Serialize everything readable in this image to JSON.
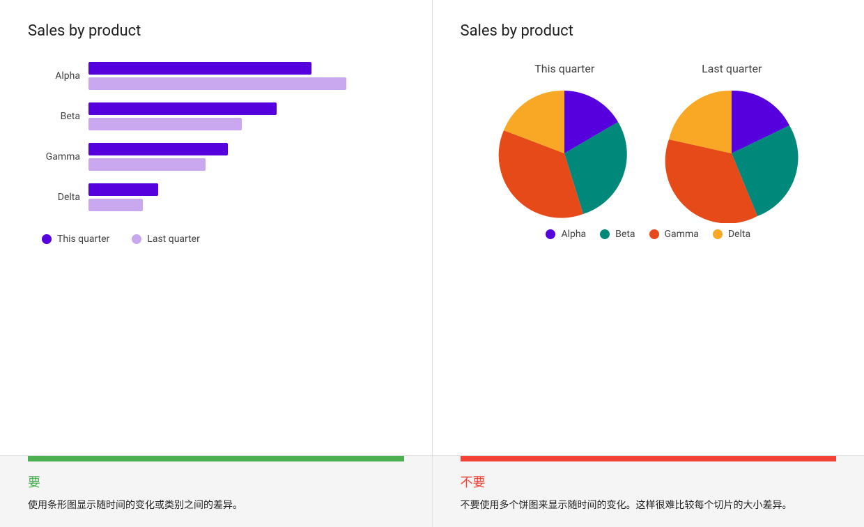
{
  "left_panel": {
    "title": "Sales by product",
    "bars": [
      {
        "label": "Alpha",
        "primary": 320,
        "secondary": 370,
        "max": 420
      },
      {
        "label": "Beta",
        "primary": 270,
        "secondary": 220,
        "max": 420
      },
      {
        "label": "Gamma",
        "primary": 200,
        "secondary": 170,
        "max": 420
      },
      {
        "label": "Delta",
        "primary": 100,
        "secondary": 80,
        "max": 420
      }
    ],
    "legend": [
      {
        "label": "This quarter",
        "color": "#5500dd"
      },
      {
        "label": "Last quarter",
        "color": "#c9a8f0"
      }
    ]
  },
  "right_panel": {
    "title": "Sales by product",
    "this_quarter_label": "This quarter",
    "last_quarter_label": "Last quarter",
    "legend": [
      {
        "label": "Alpha",
        "color": "#5500dd"
      },
      {
        "label": "Beta",
        "color": "#00897b"
      },
      {
        "label": "Gamma",
        "color": "#e64a19"
      },
      {
        "label": "Delta",
        "color": "#f9a825"
      }
    ]
  },
  "bottom_left": {
    "accent_color": "#4caf50",
    "heading": "要",
    "text": "使用条形图显示随时间的变化或类别之间的差异。"
  },
  "bottom_right": {
    "accent_color": "#f44336",
    "heading": "不要",
    "text": "不要使用多个饼图来显示随时间的变化。这样很难比较每个切片的大小差异。"
  }
}
